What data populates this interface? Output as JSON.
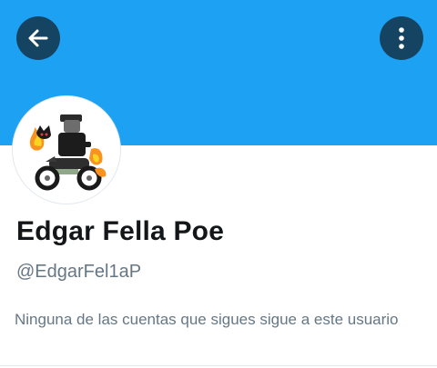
{
  "header": {
    "banner_color": "#1da1f2",
    "back_icon": "arrow-left-icon",
    "more_icon": "more-vertical-icon"
  },
  "profile": {
    "display_name": "Edgar Fella Poe",
    "handle": "@EdgarFel1aP",
    "follow_note": "Ninguna de las cuentas que sigues sigue a este usuario",
    "avatar_icon": "motorcycle-rider-avatar"
  }
}
